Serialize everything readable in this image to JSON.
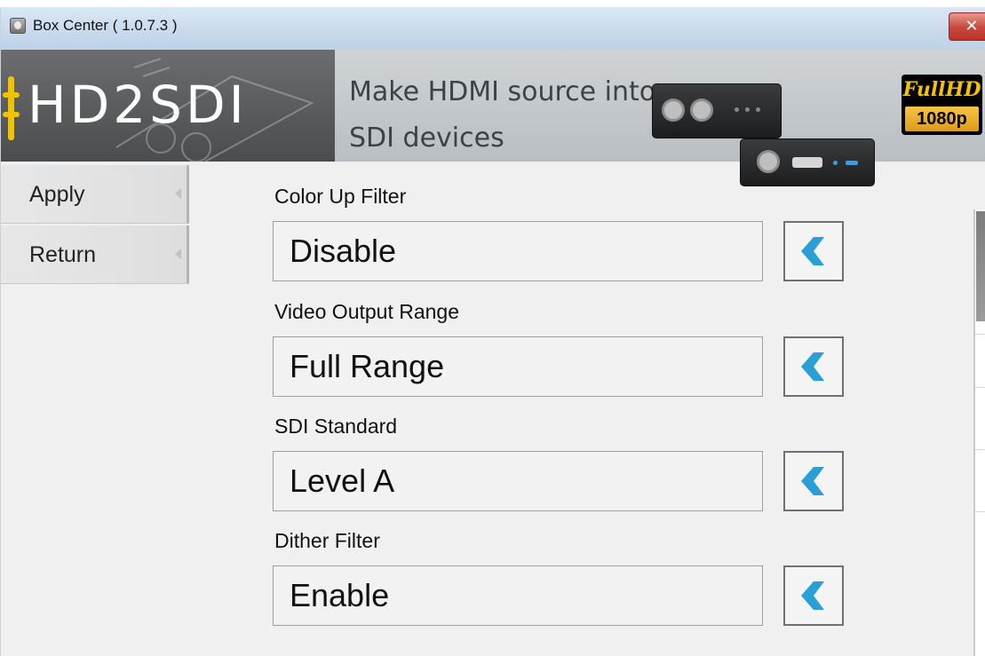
{
  "window": {
    "title": "Box Center ( 1.0.7.3 )",
    "close_label": "✕"
  },
  "banner": {
    "logo": "HD2SDI",
    "tagline_line1": "Make HDMI source into",
    "tagline_line2": "SDI devices",
    "badge_top": "FullHD",
    "badge_bottom": "1080p"
  },
  "sidebar": {
    "items": [
      {
        "label": "Apply"
      },
      {
        "label": "Return"
      }
    ]
  },
  "settings": [
    {
      "label": "Color Up Filter",
      "value": "Disable"
    },
    {
      "label": "Video Output Range",
      "value": "Full Range"
    },
    {
      "label": "SDI Standard",
      "value": "Level A"
    },
    {
      "label": "Dither Filter",
      "value": "Enable"
    }
  ],
  "icons": {
    "app": "app-icon",
    "close": "close-icon",
    "cycle": "chevron-left-icon"
  },
  "colors": {
    "accent": "#2a9fd6",
    "logo_yellow": "#f2c200",
    "close_red": "#c8463a"
  }
}
